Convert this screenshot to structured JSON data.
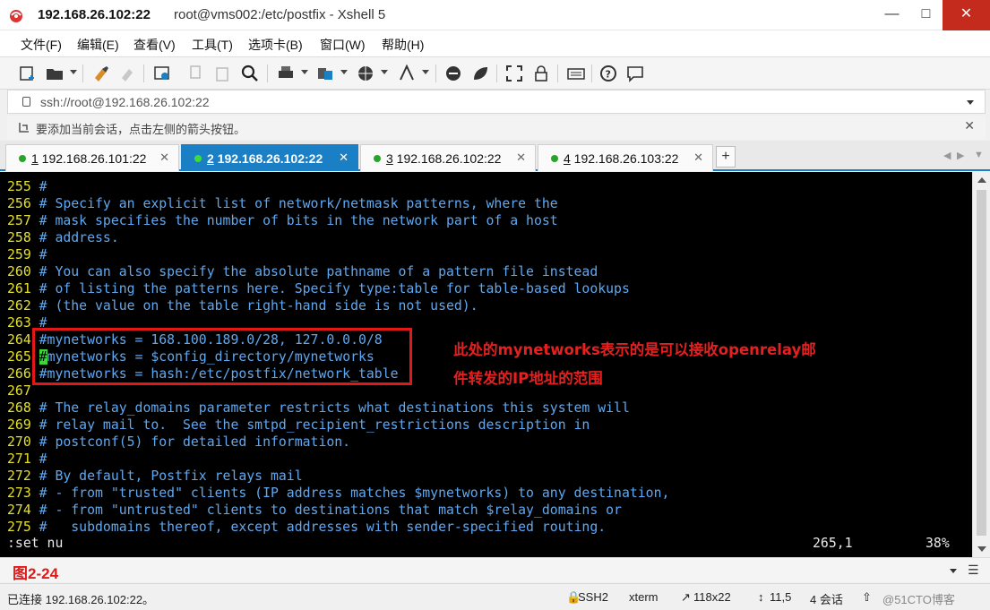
{
  "window": {
    "title_host": "192.168.26.102:22",
    "title_rest": "root@vms002:/etc/postfix - Xshell 5",
    "icon": "xshell-app-icon"
  },
  "menu": [
    {
      "label": "文件(F)"
    },
    {
      "label": "编辑(E)"
    },
    {
      "label": "查看(V)"
    },
    {
      "label": "工具(T)"
    },
    {
      "label": "选项卡(B)"
    },
    {
      "label": "窗口(W)"
    },
    {
      "label": "帮助(H)"
    }
  ],
  "address": {
    "value": "ssh://root@192.168.26.102:22"
  },
  "hint": {
    "text": "要添加当前会话，点击左侧的箭头按钮。"
  },
  "tabs": [
    {
      "num": "1",
      "label": " 192.168.26.101:22",
      "active": false
    },
    {
      "num": "2",
      "label": " 192.168.26.102:22",
      "active": true
    },
    {
      "num": "3",
      "label": " 192.168.26.102:22",
      "active": false
    },
    {
      "num": "4",
      "label": " 192.168.26.103:22",
      "active": false
    }
  ],
  "terminal": {
    "lines": [
      {
        "n": "255",
        "text": " #"
      },
      {
        "n": "256",
        "text": " # Specify an explicit list of network/netmask patterns, where the"
      },
      {
        "n": "257",
        "text": " # mask specifies the number of bits in the network part of a host"
      },
      {
        "n": "258",
        "text": " # address."
      },
      {
        "n": "259",
        "text": " #"
      },
      {
        "n": "260",
        "text": " # You can also specify the absolute pathname of a pattern file instead"
      },
      {
        "n": "261",
        "text": " # of listing the patterns here. Specify type:table for table-based lookups"
      },
      {
        "n": "262",
        "text": " # (the value on the table right-hand side is not used)."
      },
      {
        "n": "263",
        "text": " #"
      },
      {
        "n": "264",
        "text": " #mynetworks = 168.100.189.0/28, 127.0.0.0/8"
      },
      {
        "n": "265",
        "text": " #mynetworks = $config_directory/mynetworks"
      },
      {
        "n": "266",
        "text": " #mynetworks = hash:/etc/postfix/network_table"
      },
      {
        "n": "267",
        "text": ""
      },
      {
        "n": "268",
        "text": " # The relay_domains parameter restricts what destinations this system will"
      },
      {
        "n": "269",
        "text": " # relay mail to.  See the smtpd_recipient_restrictions description in"
      },
      {
        "n": "270",
        "text": " # postconf(5) for detailed information."
      },
      {
        "n": "271",
        "text": " #"
      },
      {
        "n": "272",
        "text": " # By default, Postfix relays mail"
      },
      {
        "n": "273",
        "text": " # - from \"trusted\" clients (IP address matches $mynetworks) to any destination,"
      },
      {
        "n": "274",
        "text": " # - from \"untrusted\" clients to destinations that match $relay_domains or"
      },
      {
        "n": "275",
        "text": " #   subdomains thereof, except addresses with sender-specified routing."
      }
    ],
    "command": ":set nu",
    "position": "265,1",
    "percent": "38%",
    "annotation_line1": "此处的mynetworks表示的是可以接收openrelay邮",
    "annotation_line2": "件转发的IP地址的范围"
  },
  "figure_label": "图2-24",
  "statusbar": {
    "connection": "已连接 192.168.26.102:22。",
    "protocol": "SSH2",
    "term": "xterm",
    "size": "118x22",
    "cursor": "11,5",
    "sessions": "4 会话",
    "watermark": "@51CTO博客"
  },
  "colors": {
    "accent": "#1a7fc4",
    "annotation": "#e21818",
    "line_number": "#e3e02f",
    "comment": "#5fa8f0"
  }
}
